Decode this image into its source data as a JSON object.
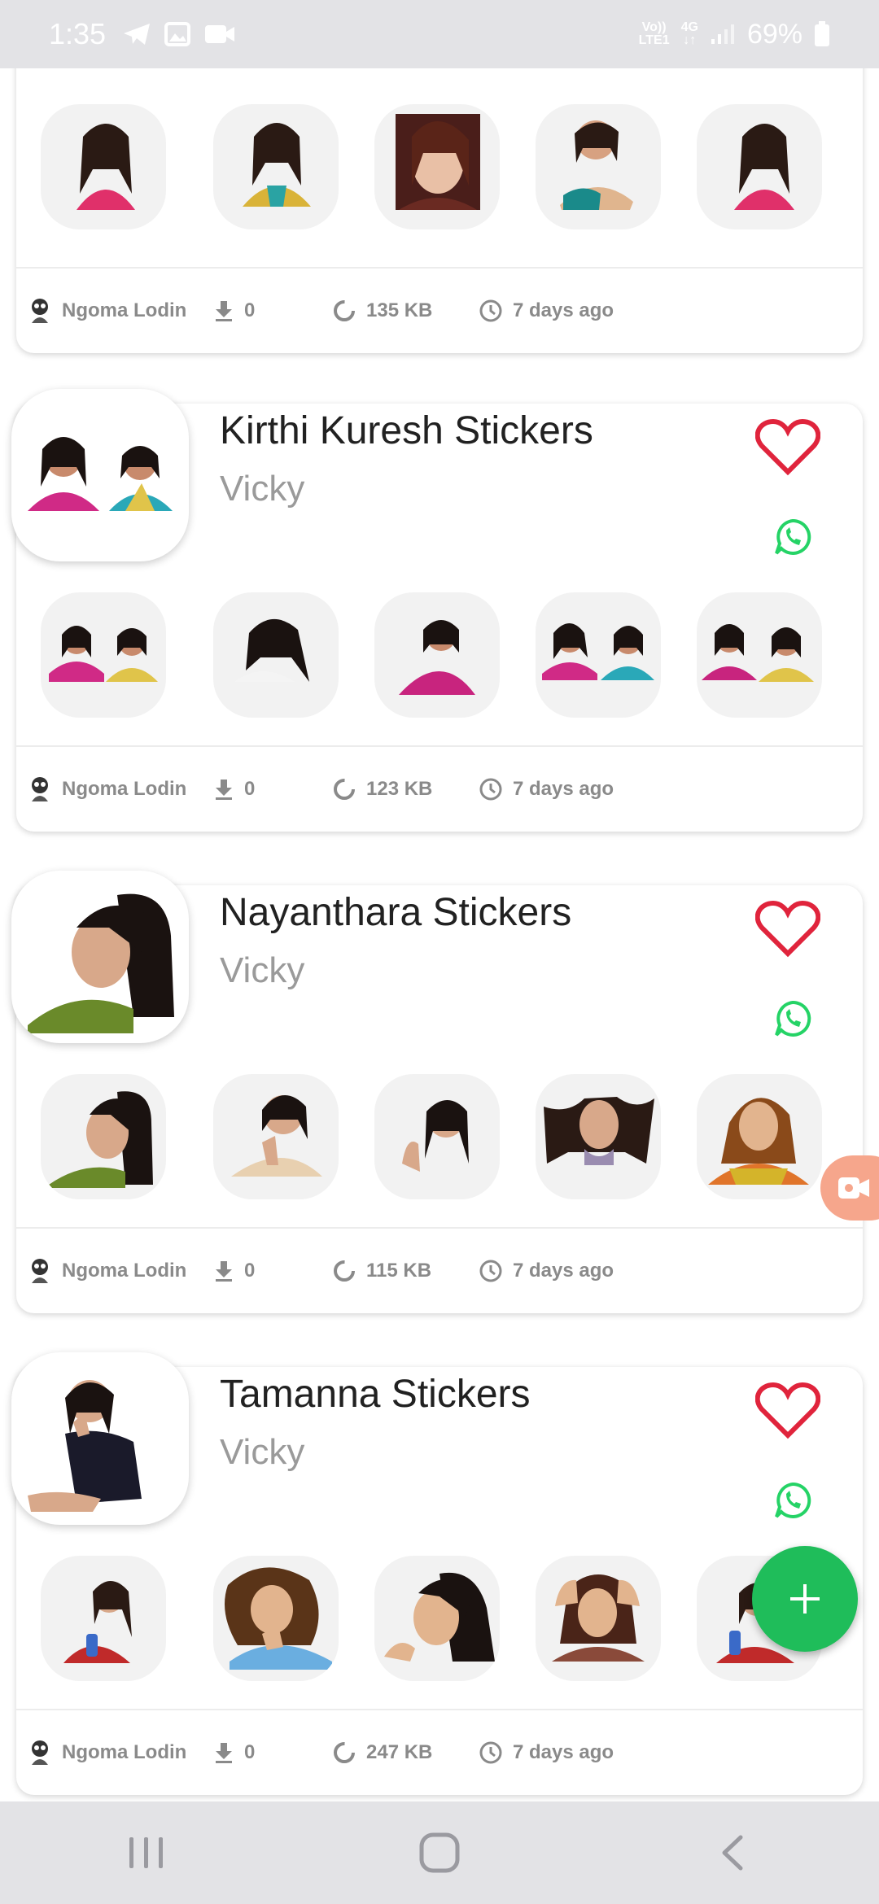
{
  "status_bar": {
    "time": "1:35",
    "network_line1": "Vo))",
    "network_line2": "LTE1",
    "network_type": "4G",
    "battery": "69%"
  },
  "packs": [
    {
      "title": "",
      "author": "",
      "publisher": "Ngoma Lodin",
      "downloads": "0",
      "size": "135 KB",
      "age": "7 days ago"
    },
    {
      "title": "Kirthi Kuresh Stickers",
      "author": "Vicky",
      "publisher": "Ngoma Lodin",
      "downloads": "0",
      "size": "123 KB",
      "age": "7 days ago"
    },
    {
      "title": "Nayanthara Stickers",
      "author": "Vicky",
      "publisher": "Ngoma Lodin",
      "downloads": "0",
      "size": "115 KB",
      "age": "7 days ago"
    },
    {
      "title": "Tamanna Stickers",
      "author": "Vicky",
      "publisher": "Ngoma Lodin",
      "downloads": "0",
      "size": "247 KB",
      "age": "7 days ago"
    }
  ],
  "colors": {
    "accent_green": "#1fbd5a",
    "heart_red": "#e0243c",
    "whatsapp_green": "#25d366"
  }
}
